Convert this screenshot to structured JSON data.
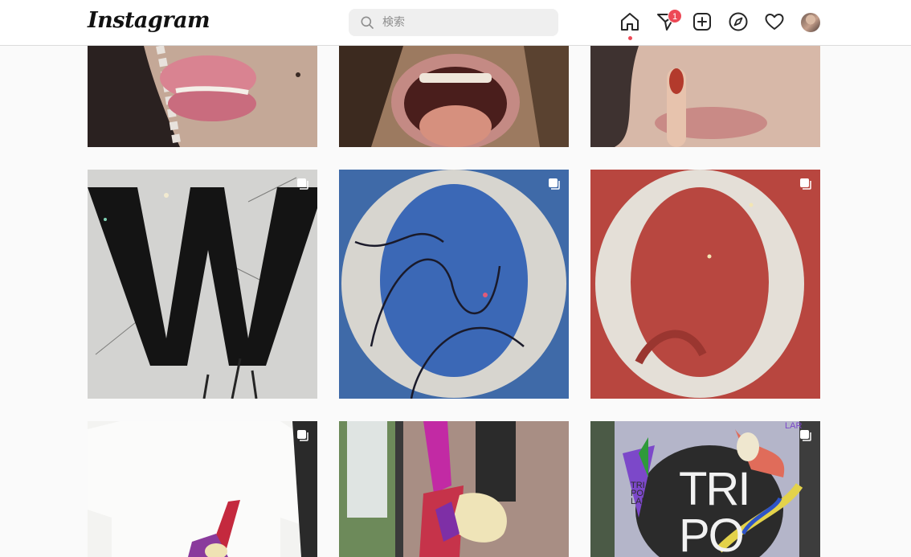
{
  "header": {
    "logo": "Instagram",
    "search_placeholder": "検索",
    "activity_badge_count": "1",
    "icons": [
      "home-icon",
      "direct-paper-plane-icon",
      "new-post-icon",
      "explore-compass-icon",
      "activity-heart-icon"
    ]
  },
  "posts": [
    {
      "id": 1,
      "subject": "lips-with-braid",
      "multiple": false
    },
    {
      "id": 2,
      "subject": "open-mouth",
      "multiple": false
    },
    {
      "id": 3,
      "subject": "finger-on-lips",
      "multiple": false
    },
    {
      "id": 4,
      "subject": "letter-W-marble",
      "multiple": true
    },
    {
      "id": 5,
      "subject": "letter-O-blue-sky",
      "multiple": true
    },
    {
      "id": 6,
      "subject": "letter-O-red",
      "multiple": true
    },
    {
      "id": 7,
      "subject": "white-tshirt",
      "multiple": true
    },
    {
      "id": 8,
      "subject": "shop-window-collage",
      "multiple": false
    },
    {
      "id": 9,
      "subject": "tripolar-poster",
      "multiple": true
    }
  ],
  "poster_text": {
    "lines": [
      "TRI",
      "PO"
    ],
    "small": [
      "TRI",
      "PO",
      "LAR"
    ],
    "corner": "LAR"
  },
  "colors": {
    "accent": "#ed4956",
    "border": "#dbdbdb",
    "background": "#fafafa",
    "search_bg": "#efefef"
  }
}
